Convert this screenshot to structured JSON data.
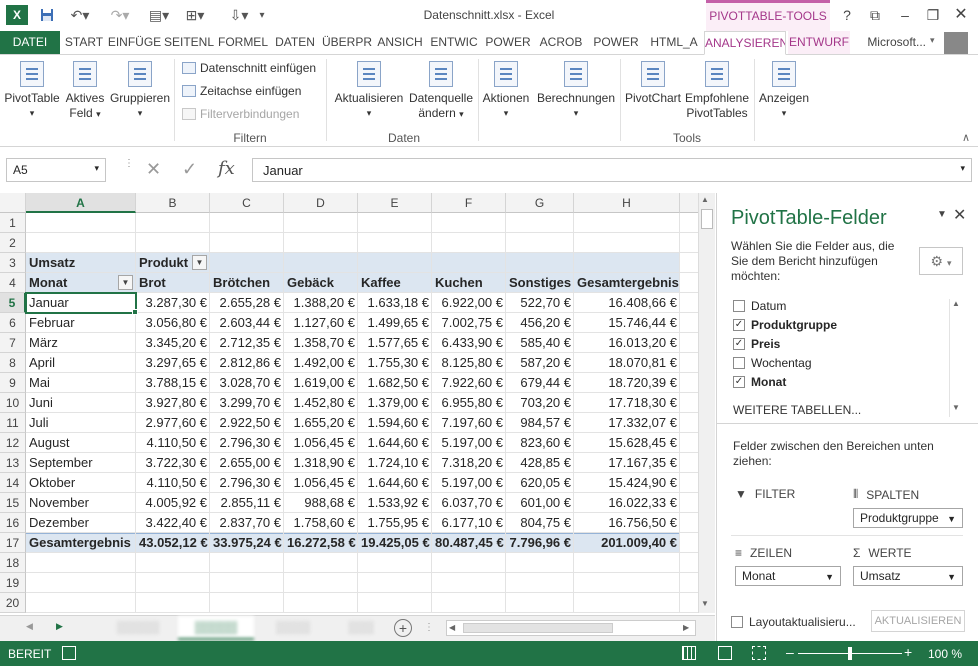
{
  "window": {
    "title": "Datenschnitt.xlsx - Excel",
    "context_title": "PIVOTTABLE-TOOLS",
    "user": "Microsoft..."
  },
  "icons": [
    "excel-logo-icon",
    "save-icon",
    "undo-icon",
    "redo-icon",
    "help-icon",
    "restore-ribbon-icon",
    "minimize-icon",
    "maximize-icon",
    "close-icon",
    "fx-icon",
    "gear-icon",
    "filter-icon",
    "columns-icon",
    "rows-icon",
    "sum-icon",
    "add-sheet-icon"
  ],
  "tabs": [
    "DATEI",
    "START",
    "EINFÜGE",
    "SEITENL",
    "FORMEL",
    "DATEN",
    "ÜBERPR",
    "ANSICH",
    "ENTWIC",
    "POWER",
    "ACROB",
    "POWER",
    "HTML_A",
    "ANALYSIEREN",
    "ENTWURF"
  ],
  "ribbon": {
    "pivottable": "PivotTable",
    "aktives": "Aktives",
    "feld": "Feld",
    "gruppieren": "Gruppieren",
    "datenschnitt": "Datenschnitt einfügen",
    "zeitachse": "Zeitachse einfügen",
    "filterverb": "Filterverbindungen",
    "aktualisieren": "Aktualisieren",
    "datenquelle": "Datenquelle",
    "aendern": "ändern",
    "aktionen": "Aktionen",
    "berechnungen": "Berechnungen",
    "pivotchart": "PivotChart",
    "empfohlene": "Empfohlene",
    "pivottables": "PivotTables",
    "anzeigen": "Anzeigen",
    "group_filtern": "Filtern",
    "group_daten": "Daten",
    "group_tools": "Tools"
  },
  "formula": {
    "namebox": "A5",
    "fx": "fx",
    "content": "Januar"
  },
  "grid": {
    "columns": [
      "A",
      "B",
      "C",
      "D",
      "E",
      "F",
      "G",
      "H"
    ],
    "rows": [
      "1",
      "2",
      "3",
      "4",
      "5",
      "6",
      "7",
      "8",
      "9",
      "10",
      "11",
      "12",
      "13",
      "14",
      "15",
      "16",
      "17",
      "18",
      "19",
      "20"
    ],
    "umsatz": "Umsatz",
    "produkt": "Produkt",
    "headers": [
      "Monat",
      "Brot",
      "Brötchen",
      "Gebäck",
      "Kaffee",
      "Kuchen",
      "Sonstiges",
      "Gesamtergebnis"
    ],
    "data": [
      [
        "Januar",
        "3.287,30 €",
        "2.655,28 €",
        "1.388,20 €",
        "1.633,18 €",
        "6.922,00 €",
        "522,70 €",
        "16.408,66 €"
      ],
      [
        "Februar",
        "3.056,80 €",
        "2.603,44 €",
        "1.127,60 €",
        "1.499,65 €",
        "7.002,75 €",
        "456,20 €",
        "15.746,44 €"
      ],
      [
        "März",
        "3.345,20 €",
        "2.712,35 €",
        "1.358,70 €",
        "1.577,65 €",
        "6.433,90 €",
        "585,40 €",
        "16.013,20 €"
      ],
      [
        "April",
        "3.297,65 €",
        "2.812,86 €",
        "1.492,00 €",
        "1.755,30 €",
        "8.125,80 €",
        "587,20 €",
        "18.070,81 €"
      ],
      [
        "Mai",
        "3.788,15 €",
        "3.028,70 €",
        "1.619,00 €",
        "1.682,50 €",
        "7.922,60 €",
        "679,44 €",
        "18.720,39 €"
      ],
      [
        "Juni",
        "3.927,80 €",
        "3.299,70 €",
        "1.452,80 €",
        "1.379,00 €",
        "6.955,80 €",
        "703,20 €",
        "17.718,30 €"
      ],
      [
        "Juli",
        "2.977,60 €",
        "2.922,50 €",
        "1.655,20 €",
        "1.594,60 €",
        "7.197,60 €",
        "984,57 €",
        "17.332,07 €"
      ],
      [
        "August",
        "4.110,50 €",
        "2.796,30 €",
        "1.056,45 €",
        "1.644,60 €",
        "5.197,00 €",
        "823,60 €",
        "15.628,45 €"
      ],
      [
        "September",
        "3.722,30 €",
        "2.655,00 €",
        "1.318,90 €",
        "1.724,10 €",
        "7.318,20 €",
        "428,85 €",
        "17.167,35 €"
      ],
      [
        "Oktober",
        "4.110,50 €",
        "2.796,30 €",
        "1.056,45 €",
        "1.644,60 €",
        "5.197,00 €",
        "620,05 €",
        "15.424,90 €"
      ],
      [
        "November",
        "4.005,92 €",
        "2.855,11 €",
        "988,68 €",
        "1.533,92 €",
        "6.037,70 €",
        "601,00 €",
        "16.022,33 €"
      ],
      [
        "Dezember",
        "3.422,40 €",
        "2.837,70 €",
        "1.758,60 €",
        "1.755,95 €",
        "6.177,10 €",
        "804,75 €",
        "16.756,50 €"
      ]
    ],
    "total": [
      "Gesamtergebnis",
      "43.052,12 €",
      "33.975,24 €",
      "16.272,58 €",
      "19.425,05 €",
      "80.487,45 €",
      "7.796,96 €",
      "201.009,40 €"
    ]
  },
  "pane": {
    "title": "PivotTable-Felder",
    "desc": "Wählen Sie die Felder aus, die Sie dem Bericht hinzufügen möchten:",
    "fields": [
      {
        "label": "Datum",
        "checked": false
      },
      {
        "label": "Produktgruppe",
        "checked": true
      },
      {
        "label": "Preis",
        "checked": true
      },
      {
        "label": "Wochentag",
        "checked": false
      },
      {
        "label": "Monat",
        "checked": true
      }
    ],
    "more_tables": "WEITERE TABELLEN...",
    "drag_hint": "Felder zwischen den Bereichen unten ziehen:",
    "filter": "FILTER",
    "spalten": "SPALTEN",
    "zeilen": "ZEILEN",
    "werte": "WERTE",
    "spalten_item": "Produktgruppe",
    "zeilen_item": "Monat",
    "werte_item": "Umsatz",
    "defer": "Layoutaktualisieru...",
    "update": "AKTUALISIEREN"
  },
  "status": {
    "mode": "BEREIT",
    "zoom": "100 %"
  }
}
